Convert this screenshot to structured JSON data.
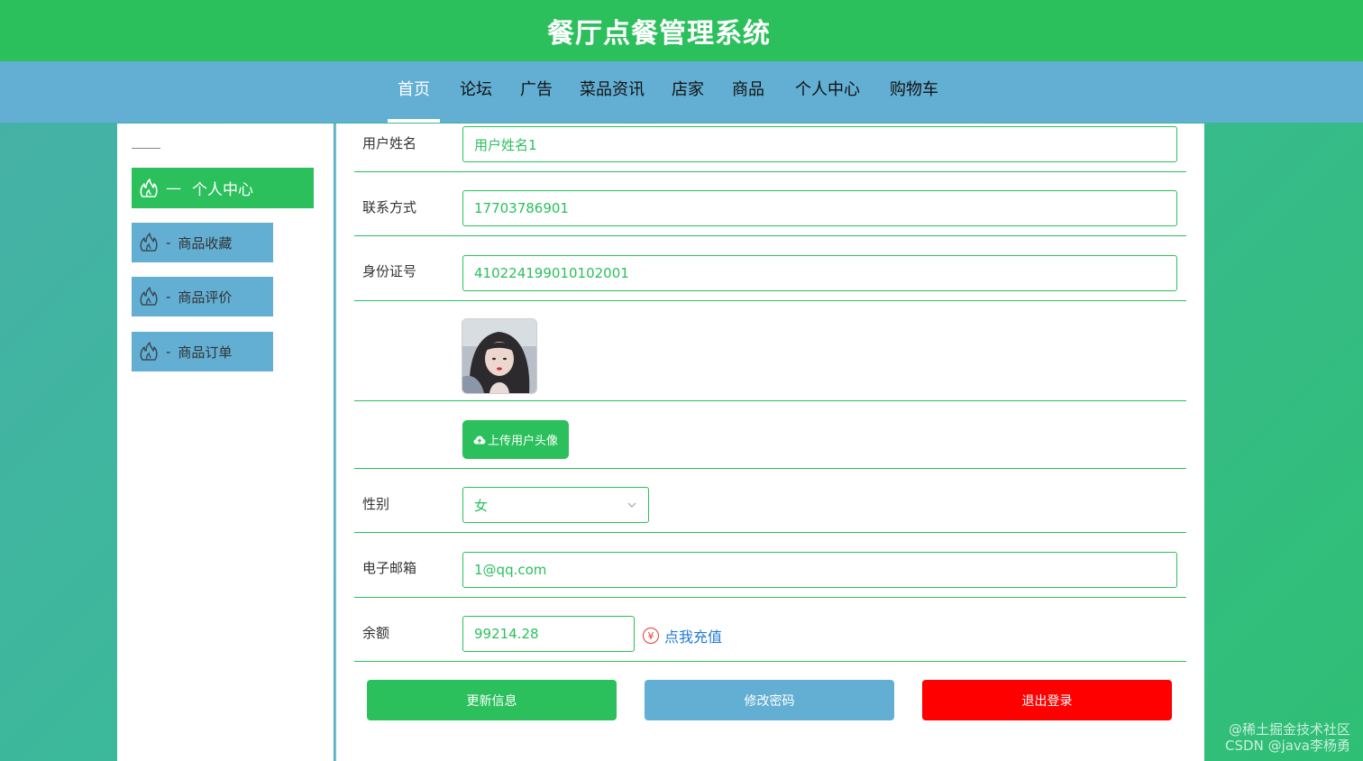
{
  "header": {
    "title": "餐厅点餐管理系统"
  },
  "nav": {
    "items": [
      "首页",
      "论坛",
      "广告",
      "菜品资讯",
      "店家",
      "商品",
      "个人中心",
      "购物车"
    ],
    "active_index": 0
  },
  "sidebar": {
    "main_label": "个人中心",
    "items": [
      "商品收藏",
      "商品评价",
      "商品订单"
    ]
  },
  "form": {
    "username": {
      "label": "用户姓名",
      "value": "用户姓名1"
    },
    "phone": {
      "label": "联系方式",
      "value": "17703786901"
    },
    "id_card": {
      "label": "身份证号",
      "value": "410224199010102001"
    },
    "upload_label": "上传用户头像",
    "gender": {
      "label": "性别",
      "value": "女"
    },
    "email": {
      "label": "电子邮箱",
      "value": "1@qq.com"
    },
    "balance": {
      "label": "余额",
      "value": "99214.28"
    },
    "recharge_label": "点我充值",
    "recharge_symbol": "¥"
  },
  "actions": {
    "update": "更新信息",
    "change_password": "修改密码",
    "logout": "退出登录"
  },
  "colors": {
    "primary_green": "#2bc05c",
    "nav_blue": "#63aed3",
    "danger_red": "#ff0000",
    "link_blue": "#1f7ad6"
  },
  "watermark": {
    "line1": "@稀土掘金技术社区",
    "line2": "CSDN @java李杨勇"
  }
}
